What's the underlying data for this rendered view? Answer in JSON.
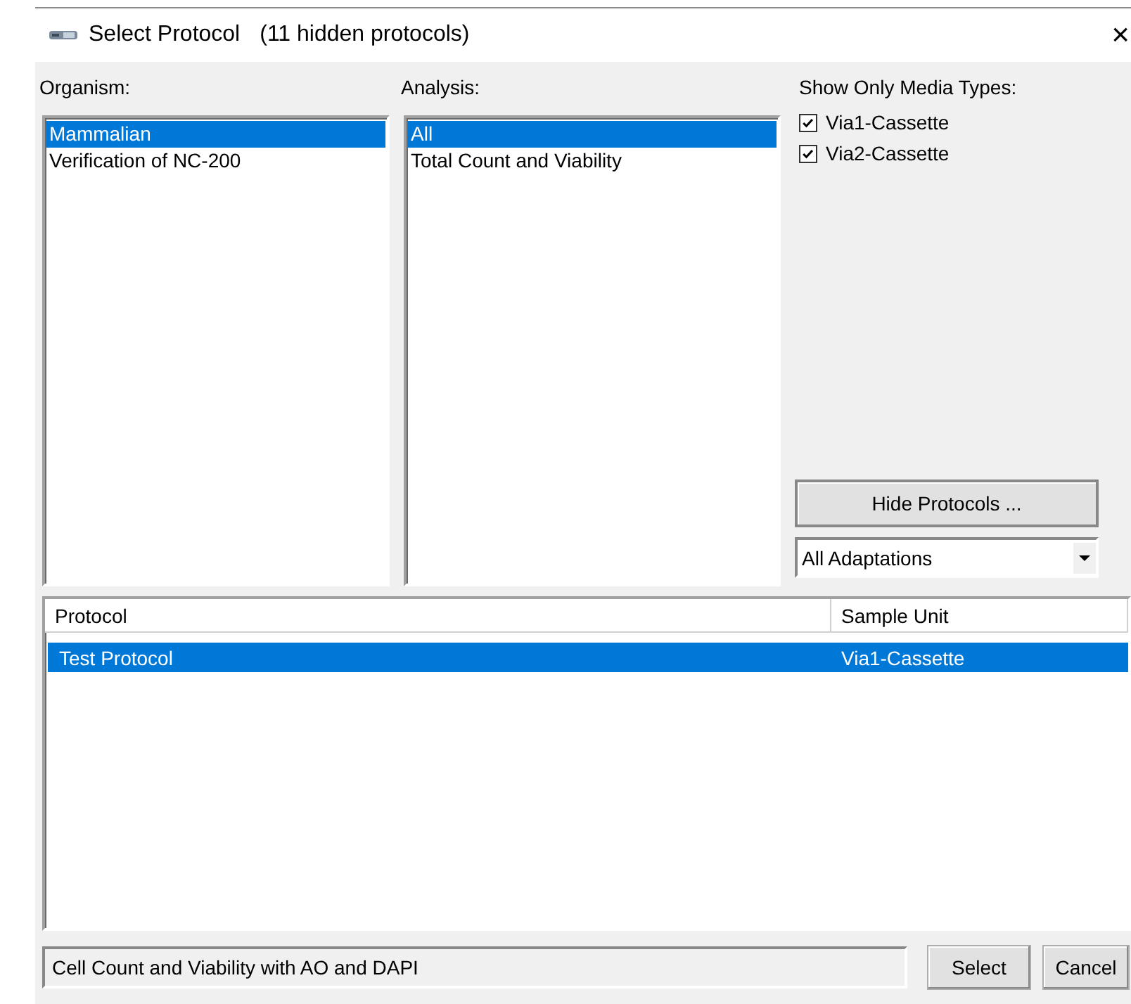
{
  "window": {
    "title": "Select Protocol",
    "subtitle": "(11 hidden protocols)",
    "close": "×"
  },
  "organism": {
    "label": "Organism:",
    "items": [
      {
        "text": "Mammalian",
        "selected": true
      },
      {
        "text": "Verification of NC-200",
        "selected": false
      }
    ]
  },
  "analysis": {
    "label": "Analysis:",
    "items": [
      {
        "text": "All",
        "selected": true
      },
      {
        "text": "Total Count and Viability",
        "selected": false
      }
    ]
  },
  "media_types": {
    "label": "Show Only Media Types:",
    "items": [
      {
        "label": "Via1-Cassette",
        "checked": true
      },
      {
        "label": "Via2-Cassette",
        "checked": true
      }
    ]
  },
  "hide_button": "Hide Protocols ...",
  "adaptations": {
    "value": "All Adaptations"
  },
  "table": {
    "columns": [
      "Protocol",
      "Sample Unit"
    ],
    "rows": [
      {
        "cells": [
          "Test Protocol",
          "Via1-Cassette"
        ],
        "selected": true
      }
    ]
  },
  "description": {
    "value": "Cell Count and Viability with AO and DAPI"
  },
  "buttons": [
    "Select",
    "Cancel"
  ]
}
